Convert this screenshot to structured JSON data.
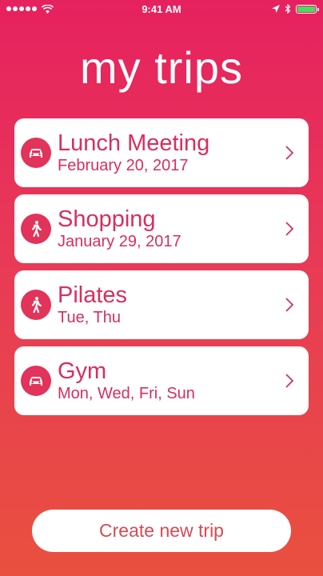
{
  "status_bar": {
    "time": "9:41 AM",
    "battery_level": 1.0,
    "colors": {
      "battery": "#4cd964"
    }
  },
  "title": "my trips",
  "trips": [
    {
      "name": "Lunch Meeting",
      "subtitle": "February 20, 2017",
      "icon": "car-icon"
    },
    {
      "name": "Shopping",
      "subtitle": "January 29, 2017",
      "icon": "walking-person-icon"
    },
    {
      "name": "Pilates",
      "subtitle": "Tue, Thu",
      "icon": "walking-person-icon"
    },
    {
      "name": "Gym",
      "subtitle": "Mon, Wed, Fri, Sun",
      "icon": "car-icon"
    }
  ],
  "create_button": {
    "label": "Create new trip"
  },
  "colors": {
    "gradient_top": "#e6215f",
    "gradient_bottom": "#e9503f",
    "accent": "#d72f5c"
  }
}
